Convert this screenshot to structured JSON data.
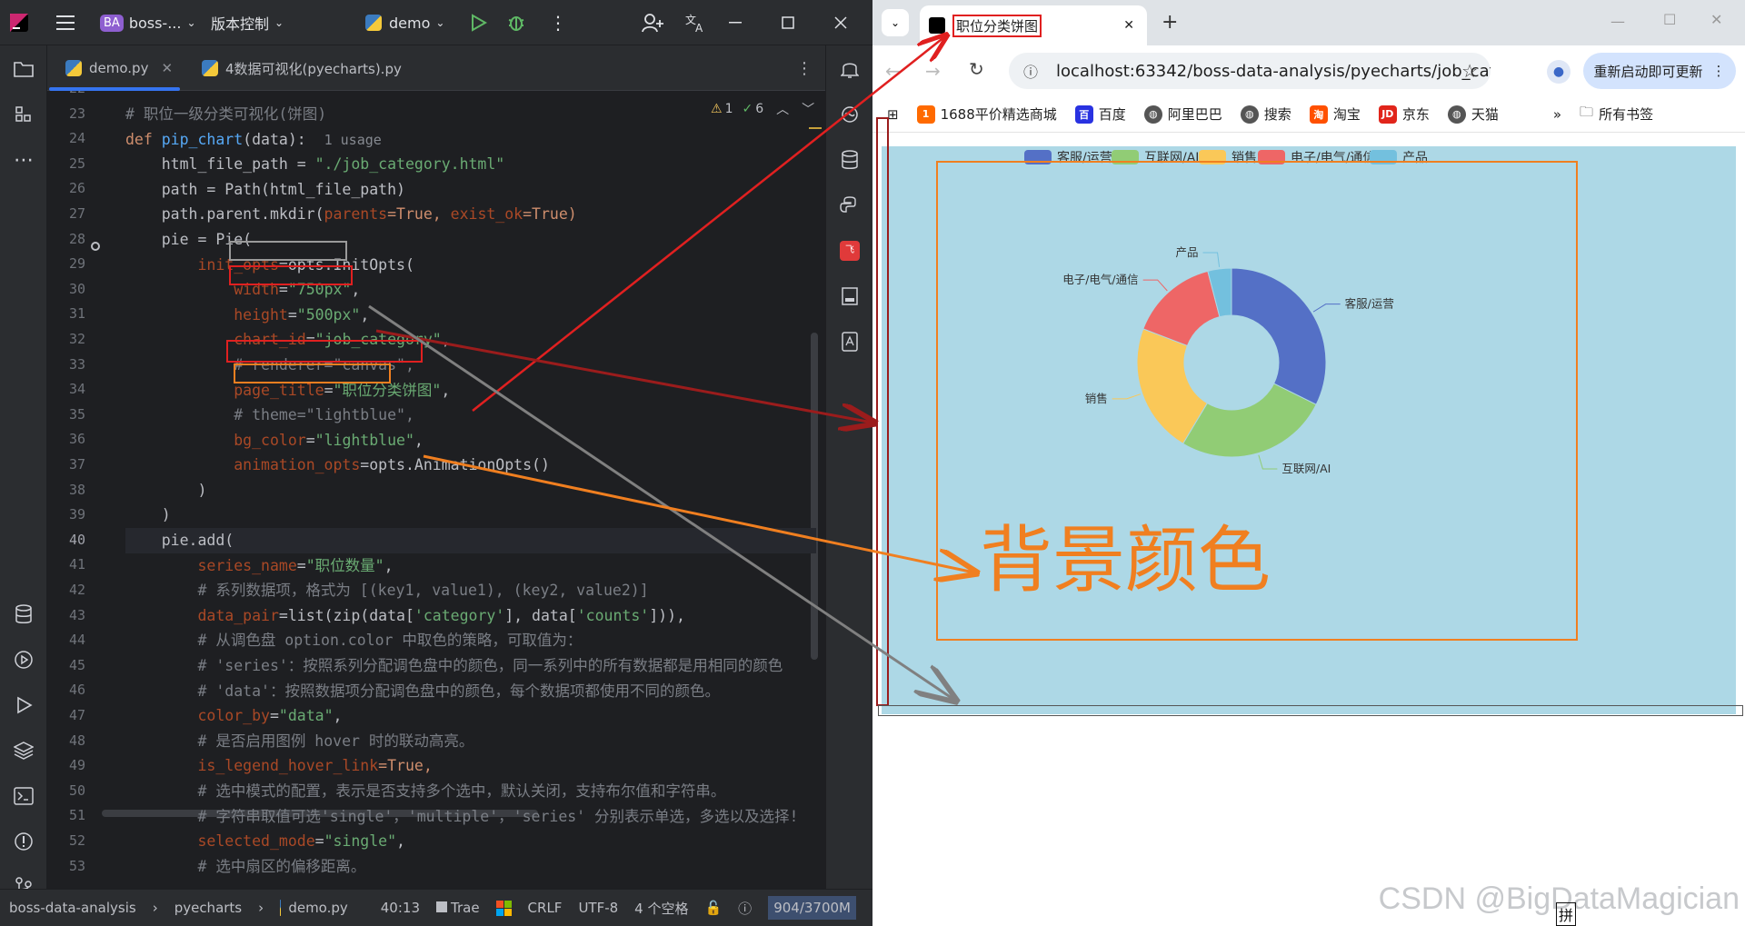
{
  "ide": {
    "project_initials": "BA",
    "project_name": "boss-...",
    "vcs_label": "版本控制",
    "run_config": "demo",
    "tabs": [
      {
        "label": "demo.py"
      },
      {
        "label": "4数据可视化(pyecharts).py"
      }
    ],
    "inspections": {
      "warnings": "1",
      "ok": "6"
    },
    "line_numbers": [
      "22",
      "23",
      "24",
      "25",
      "26",
      "27",
      "28",
      "29",
      "30",
      "31",
      "32",
      "33",
      "34",
      "35",
      "36",
      "37",
      "38",
      "39",
      "40",
      "41",
      "42",
      "43",
      "44",
      "45",
      "46",
      "47",
      "48",
      "49",
      "50",
      "51",
      "52",
      "53"
    ],
    "code": {
      "l23": "# 职位一级分类可视化(饼图)",
      "l24_def": "def ",
      "l24_fn": "pip_chart",
      "l24_args": "(data):",
      "l24_hint": "1 usage",
      "l25a": "    html_file_path = ",
      "l25b": "\"./job_category.html\"",
      "l26": "    path = Path(html_file_path)",
      "l27a": "    path.parent.mkdir(",
      "l27p1": "parents",
      "l27b": "=True, ",
      "l27p2": "exist_ok",
      "l27c": "=True)",
      "l28": "    pie = Pie(",
      "l29a": "        ",
      "l29p": "init_opts",
      "l29b": "=opts.InitOpts(",
      "l30a": "            ",
      "l30p": "width",
      "l30b": "=",
      "l30s": "\"750px\"",
      "l30c": ",",
      "l31a": "            ",
      "l31p": "height",
      "l31b": "=",
      "l31s": "\"500px\"",
      "l31c": ",",
      "l32a": "            ",
      "l32p": "chart_id",
      "l32b": "=",
      "l32s": "\"job_category\"",
      "l32c": ",",
      "l33": "            # renderer=\"canvas\",",
      "l34a": "            ",
      "l34p": "page_title",
      "l34b": "=",
      "l34s": "\"职位分类饼图\"",
      "l34c": ",",
      "l35": "            # theme=\"lightblue\",",
      "l36a": "            ",
      "l36p": "bg_color",
      "l36b": "=",
      "l36s": "\"lightblue\"",
      "l36c": ",",
      "l37a": "            ",
      "l37p": "animation_opts",
      "l37b": "=opts.AnimationOpts()",
      "l38": "        )",
      "l39": "    )",
      "l40": "    pie.add(",
      "l41a": "        ",
      "l41p": "series_name",
      "l41b": "=",
      "l41s": "\"职位数量\"",
      "l41c": ",",
      "l42": "        # 系列数据项，格式为 [(key1, value1), (key2, value2)]",
      "l43a": "        ",
      "l43p": "data_pair",
      "l43b": "=list(zip(data[",
      "l43s1": "'category'",
      "l43c": "], data[",
      "l43s2": "'counts'",
      "l43d": "])),",
      "l44": "        # 从调色盘 option.color 中取色的策略，可取值为：",
      "l45": "        # 'series'：按照系列分配调色盘中的颜色，同一系列中的所有数据都是用相同的颜色",
      "l46": "        # 'data'：按照数据项分配调色盘中的颜色，每个数据项都使用不同的颜色。",
      "l47a": "        ",
      "l47p": "color_by",
      "l47b": "=",
      "l47s": "\"data\"",
      "l47c": ",",
      "l48": "        # 是否启用图例 hover 时的联动高亮。",
      "l49a": "        ",
      "l49p": "is_legend_hover_link",
      "l49b": "=True,",
      "l50": "        # 选中模式的配置，表示是否支持多个选中，默认关闭，支持布尔值和字符串。",
      "l51": "        # 字符串取值可选'single'，'multiple'，'series' 分别表示单选，多选以及选择!",
      "l52a": "        ",
      "l52p": "selected_mode",
      "l52b": "=",
      "l52s": "\"single\"",
      "l52c": ",",
      "l53": "        # 选中扇区的偏移距离。"
    },
    "status": {
      "crumb1": "boss-data-analysis",
      "crumb2": "pyecharts",
      "crumb3": "demo.py",
      "position": "40:13",
      "plugin": "Trae",
      "line_sep": "CRLF",
      "encoding": "UTF-8",
      "indent": "4 个空格",
      "memory": "904/3700M"
    }
  },
  "browser": {
    "tab_title": "职位分类饼图",
    "url": "localhost:63342/boss-data-analysis/pyecharts/job_cat...",
    "update_button": "重新启动即可更新",
    "bookmarks": [
      "1688平价精选商城",
      "百度",
      "阿里巴巴",
      "搜索",
      "淘宝",
      "京东",
      "天猫"
    ],
    "all_bookmarks": "所有书签",
    "annotation_text": "背景颜色",
    "watermark": "CSDN @BigDataMagician",
    "ime": "拼"
  },
  "colors": {
    "chart_bg": "#add8e6",
    "annot_orange": "#f07f20",
    "annot_red": "#e02020",
    "annot_gray": "#808080"
  },
  "chart_data": {
    "type": "pie",
    "donut": true,
    "legend_placement": "top-center",
    "categories": [
      "客服/运营",
      "互联网/AI",
      "销售",
      "电子/电气/通信",
      "产品"
    ],
    "values": [
      32,
      26,
      22,
      15,
      4
    ],
    "colors": [
      "#5470c6",
      "#91cc75",
      "#fac858",
      "#ee6666",
      "#73c0de"
    ]
  }
}
